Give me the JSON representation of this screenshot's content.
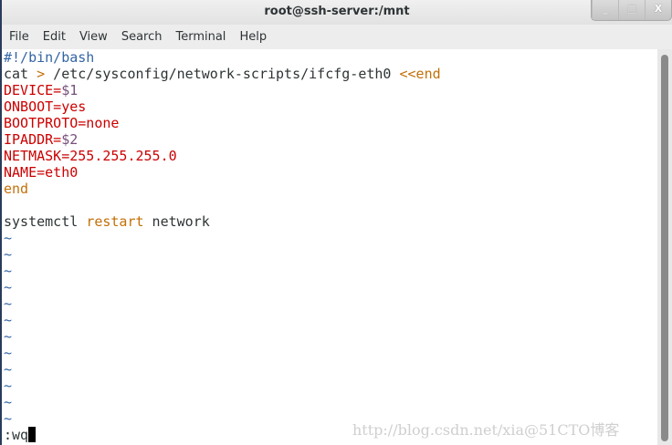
{
  "window": {
    "title": "root@ssh-server:/mnt",
    "buttons": {
      "minimize": "_",
      "maximize": "□",
      "close": "X"
    }
  },
  "menu": [
    "File",
    "Edit",
    "View",
    "Search",
    "Terminal",
    "Help"
  ],
  "editor": {
    "shebang": "#!/bin/bash",
    "cat_cmd": "cat",
    "cat_redirect": ">",
    "cat_path": " /etc/sysconfig/network-scripts/ifcfg-eth0 ",
    "cat_heredoc": "<<end",
    "device_key": "DEVICE=",
    "device_val": "$1",
    "onboot": "ONBOOT=yes",
    "bootproto": "BOOTPROTO=none",
    "ipaddr_key": "IPADDR=",
    "ipaddr_val": "$2",
    "netmask": "NETMASK=255.255.255.0",
    "name": "NAME=eth0",
    "end": "end",
    "sys_cmd": "systemctl ",
    "sys_action": "restart",
    "sys_arg": " network",
    "tilde": "~",
    "command_line": ":wq"
  },
  "watermark": "http://blog.csdn.net/xia@51CTO博客"
}
